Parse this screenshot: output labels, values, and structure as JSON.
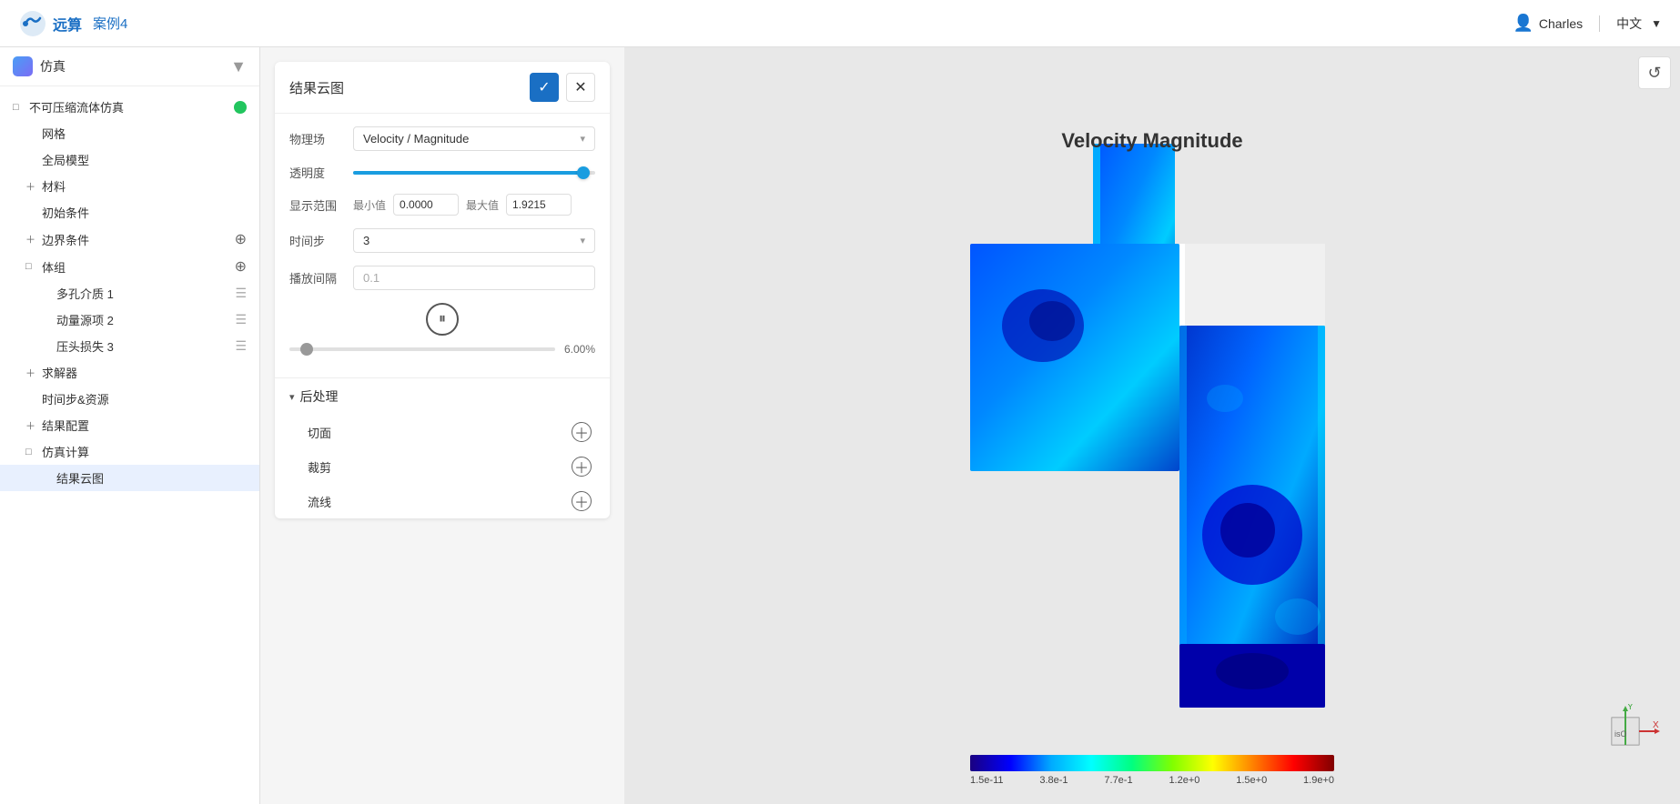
{
  "header": {
    "logo_text": "远算",
    "project_name": "案例4",
    "user_name": "Charles",
    "language": "中文",
    "lang_arrow": "▼"
  },
  "sidebar": {
    "title": "仿真",
    "collapse_icon": "▼",
    "tree": [
      {
        "level": "l1",
        "expand": "□",
        "label": "不可压缩流体仿真",
        "has_status": true,
        "id": "incompressible-sim"
      },
      {
        "level": "l2",
        "expand": "",
        "label": "网格",
        "id": "mesh"
      },
      {
        "level": "l2",
        "expand": "",
        "label": "全局模型",
        "id": "global-model"
      },
      {
        "level": "l2",
        "expand": "+",
        "label": "材料",
        "id": "materials"
      },
      {
        "level": "l2",
        "expand": "",
        "label": "初始条件",
        "id": "initial-conditions"
      },
      {
        "level": "l2",
        "expand": "+",
        "label": "边界条件",
        "id": "boundary-conditions",
        "has_add": true
      },
      {
        "level": "l2",
        "expand": "□",
        "label": "体组",
        "id": "volume-groups",
        "has_add": true
      },
      {
        "level": "l3",
        "expand": "",
        "label": "多孔介质 1",
        "id": "porous-1",
        "has_menu": true
      },
      {
        "level": "l3",
        "expand": "",
        "label": "动量源项 2",
        "id": "momentum-2",
        "has_menu": true
      },
      {
        "level": "l3",
        "expand": "",
        "label": "压头损失 3",
        "id": "head-loss-3",
        "has_menu": true
      },
      {
        "level": "l2",
        "expand": "+",
        "label": "求解器",
        "id": "solver"
      },
      {
        "level": "l2",
        "expand": "",
        "label": "时间步&资源",
        "id": "timestep-resource"
      },
      {
        "level": "l2",
        "expand": "+",
        "label": "结果配置",
        "id": "result-config"
      },
      {
        "level": "l2",
        "expand": "□",
        "label": "仿真计算",
        "id": "sim-calc"
      },
      {
        "level": "l3",
        "expand": "",
        "label": "结果云图",
        "id": "result-contour",
        "selected": true
      }
    ]
  },
  "panel": {
    "title": "结果云图",
    "physics_field_label": "物理场",
    "physics_field_value": "Velocity / Magnitude",
    "transparency_label": "透明度",
    "transparency_value": 95,
    "display_range_label": "显示范围",
    "min_label": "最小值",
    "min_value": "0.0000",
    "max_label": "最大值",
    "max_value": "1.9215",
    "timestep_label": "时间步",
    "timestep_value": "3",
    "interval_label": "播放间隔",
    "interval_value": "0.1",
    "progress_percent": "6.00%",
    "post_section_label": "后处理",
    "post_items": [
      {
        "label": "切面",
        "id": "cut-plane"
      },
      {
        "label": "裁剪",
        "id": "clip"
      },
      {
        "label": "流线",
        "id": "streamline"
      }
    ]
  },
  "colorbar": {
    "title": "Velocity Magnitude",
    "labels": [
      "1.5e-11",
      "3.8e-1",
      "7.7e-1",
      "1.2e+0",
      "1.5e+0",
      "1.9e+0"
    ]
  },
  "axes": {
    "y_label": "Y",
    "x_label": "X"
  },
  "viewport": {
    "refresh_icon": "↺"
  }
}
